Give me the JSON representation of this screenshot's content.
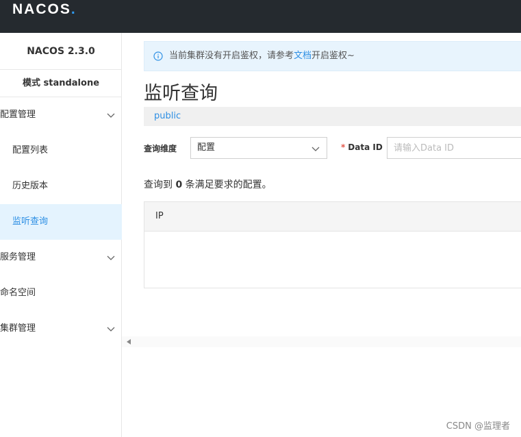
{
  "header": {
    "logo_main": "NACOS",
    "logo_dot": "."
  },
  "sidebar": {
    "version": "NACOS 2.3.0",
    "mode": "模式 standalone",
    "items": [
      {
        "label": "配置管理",
        "icon": "chevron-down-icon"
      },
      {
        "label": "配置列表"
      },
      {
        "label": "历史版本"
      },
      {
        "label": "监听查询",
        "active": true
      },
      {
        "label": "服务管理",
        "icon": "chevron-down-icon"
      },
      {
        "label": "命名空间"
      },
      {
        "label": "集群管理",
        "icon": "chevron-down-icon"
      }
    ]
  },
  "notice": {
    "prefix": "当前集群没有开启鉴权，请参考",
    "link": "文档",
    "suffix": "开启鉴权~",
    "icon": "info-icon"
  },
  "page": {
    "title": "监听查询",
    "namespace": "public"
  },
  "form": {
    "dimension_label": "查询维度",
    "dimension_value": "配置",
    "data_id_required": "*",
    "data_id_label": "Data ID",
    "data_id_placeholder": "请输入Data ID"
  },
  "result": {
    "prefix": "查询到",
    "count": "0",
    "suffix": "条满足要求的配置。"
  },
  "table": {
    "columns": [
      "IP"
    ],
    "rows": []
  },
  "watermark": "CSDN @监理者",
  "colors": {
    "topbar": "#252a2f",
    "accent": "#2d8fe4",
    "active_bg": "#e4f3fe",
    "notice_bg": "#e8f4fd"
  }
}
